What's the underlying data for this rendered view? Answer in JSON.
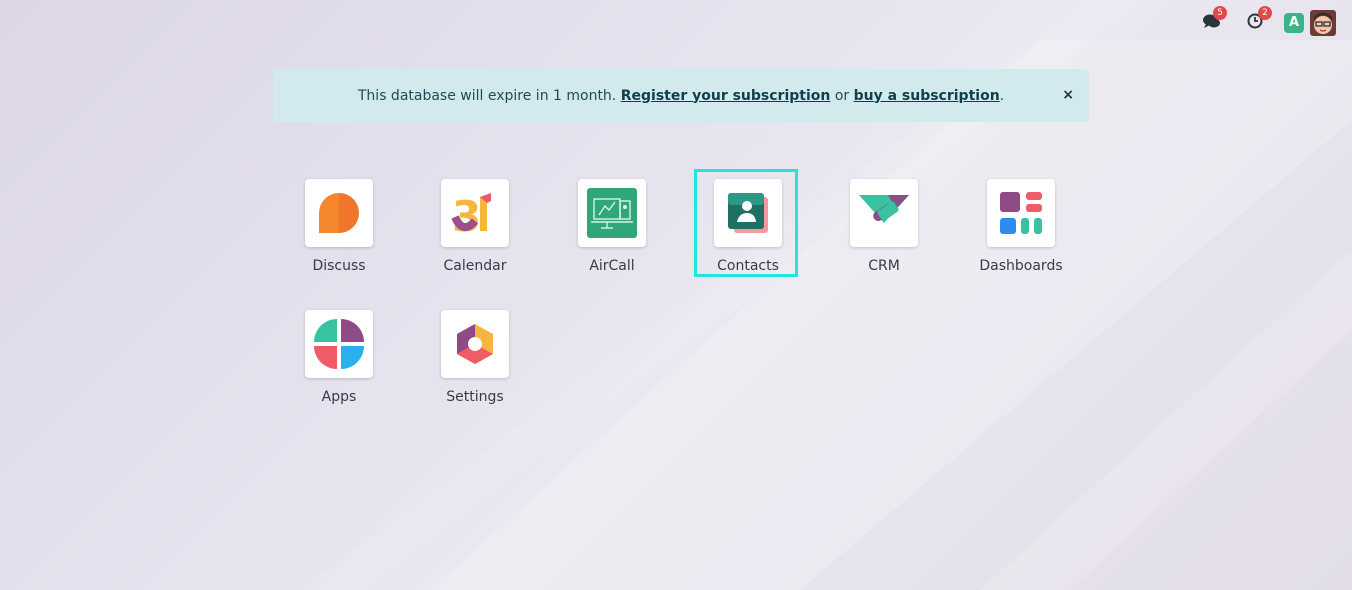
{
  "topbar": {
    "messages_icon": "chat-bubbles-icon",
    "messages_count": "5",
    "activities_icon": "clock-icon",
    "activities_count": "2",
    "company_initial": "A",
    "company_color": "#3ab58a",
    "avatar_icon": "user-avatar-icon"
  },
  "banner": {
    "text_before": "This database will expire in 1 month.",
    "register_link": "Register your subscription",
    "text_middle": "or",
    "buy_link": "buy a subscription",
    "text_after": ".",
    "close_label": "×"
  },
  "apps": [
    {
      "label": "Discuss",
      "icon": "discuss-icon"
    },
    {
      "label": "Calendar",
      "icon": "calendar-icon"
    },
    {
      "label": "AirCall",
      "icon": "aircall-icon"
    },
    {
      "label": "Contacts",
      "icon": "contacts-icon"
    },
    {
      "label": "CRM",
      "icon": "crm-icon"
    },
    {
      "label": "Dashboards",
      "icon": "dashboards-icon"
    },
    {
      "label": "Apps",
      "icon": "apps-icon"
    },
    {
      "label": "Settings",
      "icon": "settings-icon"
    }
  ],
  "colors": {
    "banner_bg": "#d2eaee",
    "focus_outline": "#22e5dd",
    "badge": "#e04a4a"
  }
}
